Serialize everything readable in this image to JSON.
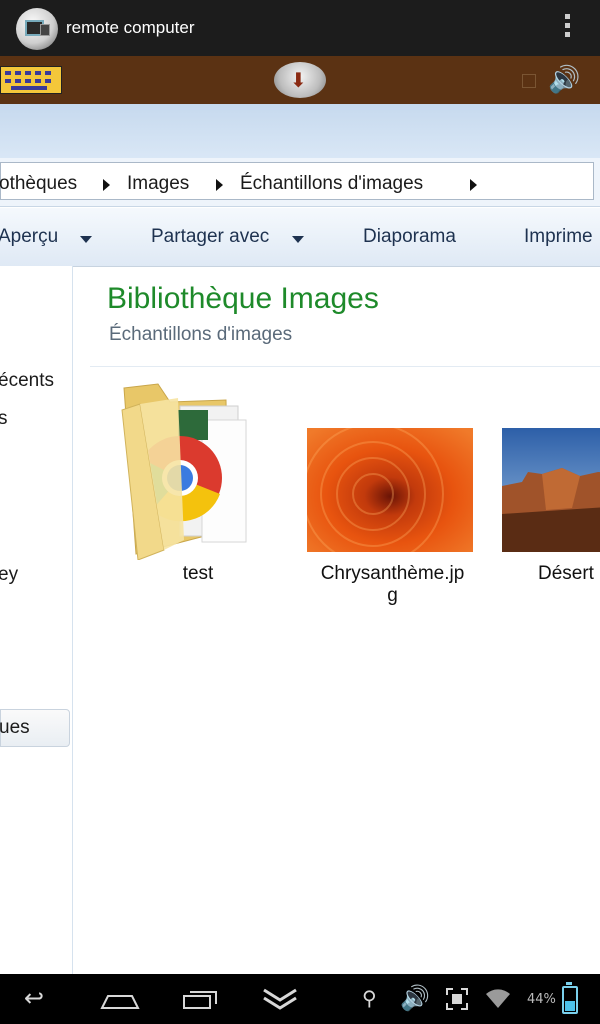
{
  "app": {
    "title": "remote computer"
  },
  "breadcrumb": [
    "othèques",
    "Images",
    "Échantillons d'images"
  ],
  "toolbar": {
    "preview": "Aperçu",
    "share": "Partager avec",
    "slideshow": "Diaporama",
    "print": "Imprime"
  },
  "nav_pane": {
    "items": [
      "écents",
      "s",
      "ey"
    ],
    "button": "ues"
  },
  "library": {
    "title": "Bibliothèque Images",
    "subtitle": "Échantillons d'images"
  },
  "files": [
    {
      "name": "test",
      "type": "folder"
    },
    {
      "name": "Chrysanthème.jpg",
      "name_line1": "Chrysanthème.jp",
      "name_line2": "g",
      "type": "image"
    },
    {
      "name": "Désert",
      "type": "image"
    }
  ],
  "status_bar": {
    "battery": "44%"
  }
}
